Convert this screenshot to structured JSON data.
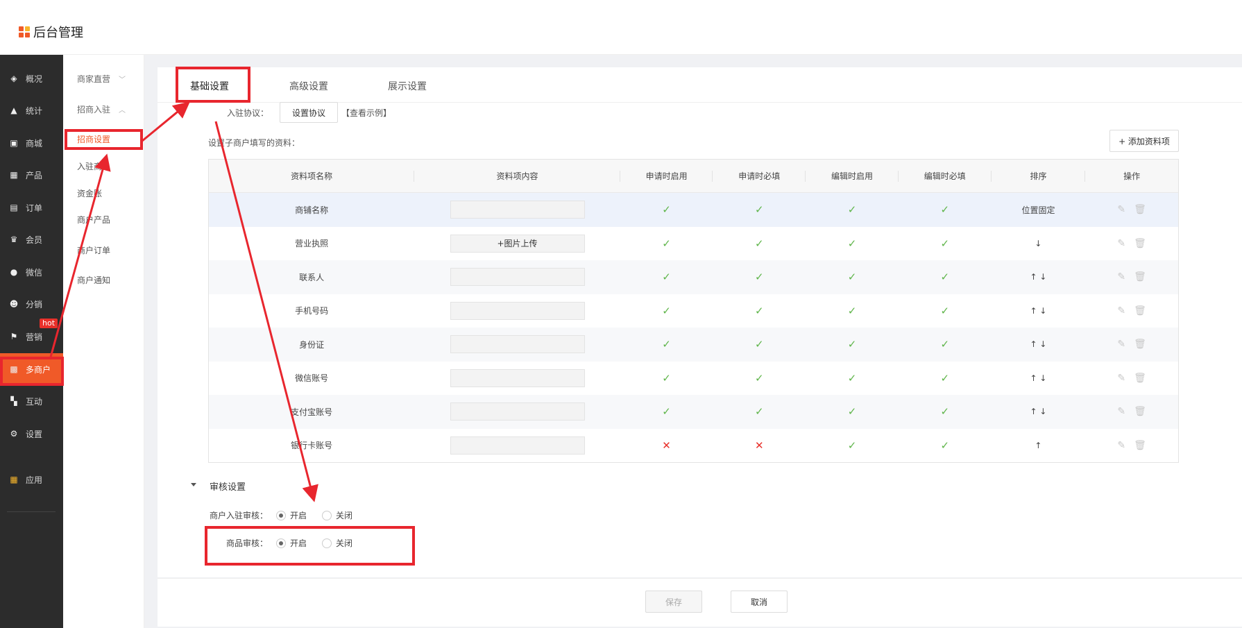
{
  "app": {
    "title": "后台管理"
  },
  "sidebar": {
    "items": [
      {
        "label": "概况",
        "icon": "layers-icon"
      },
      {
        "label": "统计",
        "icon": "chart-icon"
      },
      {
        "label": "商城",
        "icon": "store-icon"
      },
      {
        "label": "产品",
        "icon": "grid-icon"
      },
      {
        "label": "订单",
        "icon": "order-icon"
      },
      {
        "label": "会员",
        "icon": "crown-icon"
      },
      {
        "label": "微信",
        "icon": "wechat-icon"
      },
      {
        "label": "分销",
        "icon": "user-icon"
      },
      {
        "label": "营销",
        "icon": "flag-icon"
      },
      {
        "label": "多商户",
        "icon": "merchant-icon"
      },
      {
        "label": "互动",
        "icon": "interact-icon"
      },
      {
        "label": "设置",
        "icon": "gear-icon"
      },
      {
        "label": "应用",
        "icon": "apps-icon"
      }
    ],
    "hot_badge": "hot"
  },
  "submenu": {
    "group1": "商家直营",
    "group2": "招商入驻",
    "items": [
      "招商设置",
      "入驻商户",
      "资金账",
      "商户产品",
      "商户订单",
      "商户通知"
    ]
  },
  "tabs": [
    "基础设置",
    "高级设置",
    "展示设置"
  ],
  "agreement": {
    "label": "入驻协议：",
    "button": "设置协议",
    "link": "【查看示例】"
  },
  "fields_label": "设置子商户填写的资料：",
  "add_button": "+ 添加资料项",
  "table": {
    "headers": [
      "资料项名称",
      "资料项内容",
      "申请时启用",
      "申请时必填",
      "编辑时启用",
      "编辑时必填",
      "排序",
      "操作"
    ],
    "rows": [
      {
        "name": "商铺名称",
        "content": "",
        "apply_enable": true,
        "apply_required": true,
        "edit_enable": true,
        "edit_required": true,
        "sort": "位置固定"
      },
      {
        "name": "营业执照",
        "content": "+图片上传",
        "apply_enable": true,
        "apply_required": true,
        "edit_enable": true,
        "edit_required": true,
        "sort": "↓"
      },
      {
        "name": "联系人",
        "content": "",
        "apply_enable": true,
        "apply_required": true,
        "edit_enable": true,
        "edit_required": true,
        "sort": "↑ ↓"
      },
      {
        "name": "手机号码",
        "content": "",
        "apply_enable": true,
        "apply_required": true,
        "edit_enable": true,
        "edit_required": true,
        "sort": "↑ ↓"
      },
      {
        "name": "身份证",
        "content": "",
        "apply_enable": true,
        "apply_required": true,
        "edit_enable": true,
        "edit_required": true,
        "sort": "↑ ↓"
      },
      {
        "name": "微信账号",
        "content": "",
        "apply_enable": true,
        "apply_required": true,
        "edit_enable": true,
        "edit_required": true,
        "sort": "↑ ↓"
      },
      {
        "name": "支付宝账号",
        "content": "",
        "apply_enable": true,
        "apply_required": true,
        "edit_enable": true,
        "edit_required": true,
        "sort": "↑ ↓"
      },
      {
        "name": "银行卡账号",
        "content": "",
        "apply_enable": false,
        "apply_required": false,
        "edit_enable": true,
        "edit_required": true,
        "sort": "↑"
      }
    ]
  },
  "review": {
    "title": "审核设置",
    "merchant_label": "商户入驻审核：",
    "product_label": "商品审核：",
    "on": "开启",
    "off": "关闭"
  },
  "footer": {
    "save": "保存",
    "cancel": "取消"
  },
  "colors": {
    "accent": "#f05a28",
    "annotation": "#e8262e",
    "sidebar": "#2c2c2c",
    "check": "#5fb54a"
  }
}
